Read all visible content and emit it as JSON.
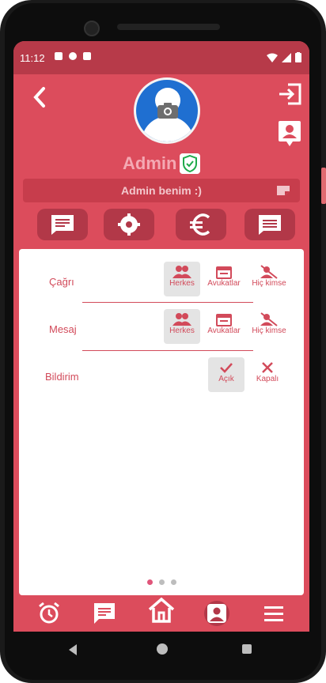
{
  "status_bar": {
    "time": "11:12"
  },
  "profile": {
    "name": "Admin",
    "bio": "Admin benim :)"
  },
  "settings": {
    "rows": [
      {
        "label": "Çağrı",
        "options": [
          "Herkes",
          "Avukatlar",
          "Hiç kimse"
        ],
        "selected": "Herkes"
      },
      {
        "label": "Mesaj",
        "options": [
          "Herkes",
          "Avukatlar",
          "Hiç kimse"
        ],
        "selected": "Herkes"
      },
      {
        "label": "Bildirim",
        "options": [
          "Açık",
          "Kapalı"
        ],
        "selected": "Açık"
      }
    ]
  },
  "pager": {
    "pages": 3,
    "current": 1
  },
  "colors": {
    "primary": "#dc4c5c",
    "dark": "#b23848",
    "accent": "#d24a5a",
    "avatar": "#1f6fd1"
  },
  "icons": {
    "top": [
      "back-icon",
      "logout-icon",
      "contact-icon",
      "camera-icon",
      "verified-icon",
      "edit-icon"
    ],
    "actions": [
      "message-icon",
      "settings-gear-icon",
      "euro-icon",
      "chat-icon"
    ],
    "bottom_nav": [
      "alarm-icon",
      "message-icon",
      "home-icon",
      "profile-icon",
      "menu-icon"
    ]
  }
}
